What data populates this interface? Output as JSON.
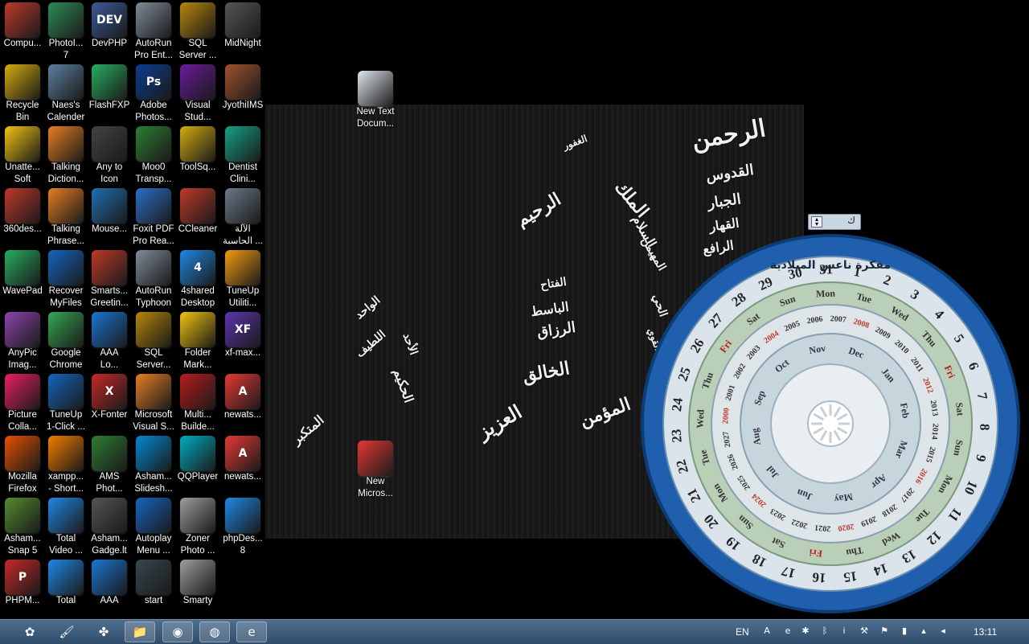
{
  "desktop_icons": [
    {
      "label": "Compu...",
      "icon": "computer-icon",
      "color": "#c0392b"
    },
    {
      "label": "PhotoI...\n7",
      "icon": "photoimpact-icon",
      "color": "#2e8b57"
    },
    {
      "label": "DevPHP",
      "icon": "devphp-icon",
      "color": "#3d5a99",
      "glyph": "DEV"
    },
    {
      "label": "AutoRun\nPro Ent...",
      "icon": "cd-globe-icon",
      "color": "#7f8c9a"
    },
    {
      "label": "SQL\nServer ...",
      "icon": "sql-tools-icon",
      "color": "#b8860b"
    },
    {
      "label": "MidNight",
      "icon": "midnight-icon",
      "color": "#555555"
    },
    {
      "label": "Recycle\nBin",
      "icon": "recycle-bin-icon",
      "color": "#d4ac0d"
    },
    {
      "label": "Naes's\nCalender",
      "icon": "calendar-globe-icon",
      "color": "#5d7f9e"
    },
    {
      "label": "FlashFXP",
      "icon": "flashfxp-icon",
      "color": "#27ae60"
    },
    {
      "label": "Adobe\nPhotos...",
      "icon": "photoshop-icon",
      "color": "#0b3d91",
      "glyph": "Ps"
    },
    {
      "label": "Visual\nStud...",
      "icon": "visual-studio-icon",
      "color": "#6a1b9a"
    },
    {
      "label": "JyothiIMS",
      "icon": "jyothiims-icon",
      "color": "#a0522d"
    },
    {
      "label": "Unatte...\nSoft",
      "icon": "star-icon",
      "color": "#f1c40f"
    },
    {
      "label": "Talking\nDiction...",
      "icon": "dictionary-icon",
      "color": "#e67e22"
    },
    {
      "label": "Any to\nIcon",
      "icon": "any-to-icon-icon",
      "color": "#444444"
    },
    {
      "label": "Moo0\nTransp...",
      "icon": "moo0-icon",
      "color": "#2e7d32"
    },
    {
      "label": "ToolSq...",
      "icon": "database-icon",
      "color": "#d4ac0d"
    },
    {
      "label": "Dentist\nClini...",
      "icon": "dentist-icon",
      "color": "#16a085"
    },
    {
      "label": "360des...",
      "icon": "360desktop-icon",
      "color": "#c0392b"
    },
    {
      "label": "Talking\nPhrase...",
      "icon": "phrase-globe-icon",
      "color": "#e67e22"
    },
    {
      "label": "Mouse...",
      "icon": "mouse-icon",
      "color": "#1f6fb2"
    },
    {
      "label": "Foxit PDF\nPro Rea...",
      "icon": "foxit-icon",
      "color": "#2a6fc9"
    },
    {
      "label": "CCleaner",
      "icon": "ccleaner-icon",
      "color": "#c0392b"
    },
    {
      "label": "الآلة\nالحاسبة ...",
      "icon": "calculator-icon",
      "color": "#6c7a89"
    },
    {
      "label": "WavePad",
      "icon": "wavepad-icon",
      "color": "#27ae60"
    },
    {
      "label": "Recover\nMyFiles",
      "icon": "recover-icon",
      "color": "#1565c0"
    },
    {
      "label": "Smarts...\nGreetin...",
      "icon": "heart-icon",
      "color": "#c0392b"
    },
    {
      "label": "AutoRun\nTyphoon",
      "icon": "autorun-icon",
      "color": "#7f8c9a"
    },
    {
      "label": "4shared\nDesktop",
      "icon": "4shared-icon",
      "color": "#1e88e5",
      "glyph": "4"
    },
    {
      "label": "TuneUp\nUtiliti...",
      "icon": "tuneup-icon",
      "color": "#f39c12"
    },
    {
      "label": "AnyPic\nImag...",
      "icon": "anypic-icon",
      "color": "#8e44ad"
    },
    {
      "label": "Google\nChrome",
      "icon": "chrome-icon",
      "color": "#34a853"
    },
    {
      "label": "AAA\nLo...",
      "icon": "aaa-logo-icon",
      "color": "#1976d2"
    },
    {
      "label": "SQL\nServer...",
      "icon": "sql-tools-icon",
      "color": "#b8860b"
    },
    {
      "label": "Folder\nMark...",
      "icon": "folder-marker-icon",
      "color": "#f1c40f"
    },
    {
      "label": "xf-max...",
      "icon": "xf-max-icon",
      "color": "#5e35b1",
      "glyph": "XF"
    },
    {
      "label": "Picture\nColla...",
      "icon": "picture-collage-icon",
      "color": "#e91e63"
    },
    {
      "label": "TuneUp\n1-Click ...",
      "icon": "tuneup-1click-icon",
      "color": "#1565c0"
    },
    {
      "label": "X-Fonter",
      "icon": "x-fonter-icon",
      "color": "#c62828",
      "glyph": "X"
    },
    {
      "label": "Microsoft\nVisual S...",
      "icon": "visual-studio-icon",
      "color": "#e67e22"
    },
    {
      "label": "Multi...\nBuilde...",
      "icon": "multi-builder-icon",
      "color": "#b71c1c"
    },
    {
      "label": "newats...",
      "icon": "access-icon",
      "color": "#e53935",
      "glyph": "A"
    },
    {
      "label": "Mozilla\nFirefox",
      "icon": "firefox-icon",
      "color": "#e65100"
    },
    {
      "label": "xampp...\n- Short...",
      "icon": "xampp-icon",
      "color": "#f57c00"
    },
    {
      "label": "AMS\nPhot...",
      "icon": "ams-photo-icon",
      "color": "#2e7d32"
    },
    {
      "label": "Asham...\nSlidesh...",
      "icon": "ashampoo-slideshow-icon",
      "color": "#0288d1"
    },
    {
      "label": "QQPlayer",
      "icon": "qqplayer-icon",
      "color": "#00acc1"
    },
    {
      "label": "newats...",
      "icon": "access-icon",
      "color": "#e53935",
      "glyph": "A"
    },
    {
      "label": "Asham...\nSnap 5",
      "icon": "ashampoo-snap-icon",
      "color": "#558b2f"
    },
    {
      "label": "Total\nVideo ...",
      "icon": "total-video-icon",
      "color": "#1e88e5"
    },
    {
      "label": "Asham...\nGadge.lt",
      "icon": "ashampoo-gadget-icon",
      "color": "#555555"
    },
    {
      "label": "Autoplay\nMenu ...",
      "icon": "autoplay-icon",
      "color": "#1565c0"
    },
    {
      "label": "Zoner\nPhoto ...",
      "icon": "zoner-icon",
      "color": "#9e9e9e"
    },
    {
      "label": "phpDes...\n8",
      "icon": "phpdesigner-icon",
      "color": "#1e88e5"
    },
    {
      "label": "PHPM...",
      "icon": "phpmaker-icon",
      "color": "#c62828",
      "glyph": "P"
    },
    {
      "label": "Total",
      "icon": "total-icon",
      "color": "#1e88e5"
    },
    {
      "label": "AAA",
      "icon": "aaa-icon",
      "color": "#1976d2"
    },
    {
      "label": "start",
      "icon": "start-shortcut-icon",
      "color": "#37474f"
    },
    {
      "label": "Smarty",
      "icon": "smarty-icon",
      "color": "#9e9e9e"
    }
  ],
  "loose_icons": [
    {
      "label": "New Text\nDocum...",
      "icon": "text-document-icon",
      "color": "#e0e6ee"
    },
    {
      "label": "New\nMicros...",
      "icon": "access-document-icon",
      "color": "#e53935"
    }
  ],
  "wallpaper_text": [
    "الرحمن",
    "القدوس",
    "الجبار",
    "القهار",
    "الرافع",
    "الملك",
    "السلام",
    "المهيمن",
    "العزيز",
    "المؤمن",
    "الخالق",
    "الرزاق",
    "الرحيم",
    "الحي",
    "المتكبر",
    "الأحد",
    "الحكيم",
    "القوي",
    "الغفور",
    "الواحد",
    "الباسط",
    "الفتاح",
    "اللطيف"
  ],
  "calendar_gadget": {
    "title": "مفكرة ناعس الميلادية",
    "days_of_month": [
      "1",
      "2",
      "3",
      "4",
      "5",
      "6",
      "7",
      "8",
      "9",
      "10",
      "11",
      "12",
      "13",
      "14",
      "15",
      "16",
      "17",
      "18",
      "19",
      "20",
      "21",
      "22",
      "23",
      "24",
      "25",
      "26",
      "27",
      "28",
      "29",
      "30",
      "31"
    ],
    "weekdays": [
      "Tue",
      "Wed",
      "Thu",
      "Fri",
      "Sat",
      "Sun",
      "Mon",
      "Tue",
      "Wed",
      "Thu",
      "Fri",
      "Sat",
      "Sun",
      "Mon",
      "Tue",
      "Wed",
      "Thu",
      "Fri",
      "Sat",
      "Sun",
      "Mon"
    ],
    "years": [
      "2009",
      "2010",
      "2011",
      "2012",
      "2013",
      "2014",
      "2015",
      "2016",
      "2017",
      "2018",
      "2019",
      "2020",
      "2021",
      "2022",
      "2023",
      "2024",
      "2025",
      "2026",
      "2027",
      "2000",
      "2001",
      "2002",
      "2003",
      "2004",
      "2005",
      "2006",
      "2007",
      "2008"
    ],
    "months": [
      "Jan",
      "Feb",
      "Mar",
      "Apr",
      "May",
      "Jun",
      "Jul",
      "Aug",
      "Sep",
      "Oct",
      "Nov",
      "Dec"
    ],
    "bar_label": "ك"
  },
  "taskbar": {
    "buttons": [
      {
        "icon": "ashampoo-taskbar-icon",
        "label": "✿"
      },
      {
        "icon": "paint-taskbar-icon",
        "label": "🖌"
      },
      {
        "icon": "butterfly-taskbar-icon",
        "label": "✤"
      },
      {
        "icon": "explorer-taskbar-icon",
        "label": "📁"
      },
      {
        "icon": "firefox-taskbar-icon",
        "label": "◉"
      },
      {
        "icon": "media-taskbar-icon",
        "label": "◍"
      },
      {
        "icon": "ie-taskbar-icon",
        "label": "e"
      }
    ],
    "language": "EN",
    "clock": "13:11",
    "tray_icons": [
      {
        "icon": "adobe-tray-icon",
        "label": "A"
      },
      {
        "icon": "ie-tray-icon",
        "label": "e"
      },
      {
        "icon": "sun-tray-icon",
        "label": "✱"
      },
      {
        "icon": "bluetooth-tray-icon",
        "label": "ᛒ"
      },
      {
        "icon": "info-tray-icon",
        "label": "i"
      },
      {
        "icon": "gavel-tray-icon",
        "label": "⚒"
      },
      {
        "icon": "flag-tray-icon",
        "label": "⚑"
      },
      {
        "icon": "battery-tray-icon",
        "label": "▮"
      },
      {
        "icon": "signal-tray-icon",
        "label": "▴"
      },
      {
        "icon": "volume-tray-icon",
        "label": "◂"
      }
    ]
  },
  "colors": {
    "taskbar": "#3a5a7c",
    "gadget_ring": "#1f5fae",
    "gadget_face": "#dbe4ea"
  }
}
